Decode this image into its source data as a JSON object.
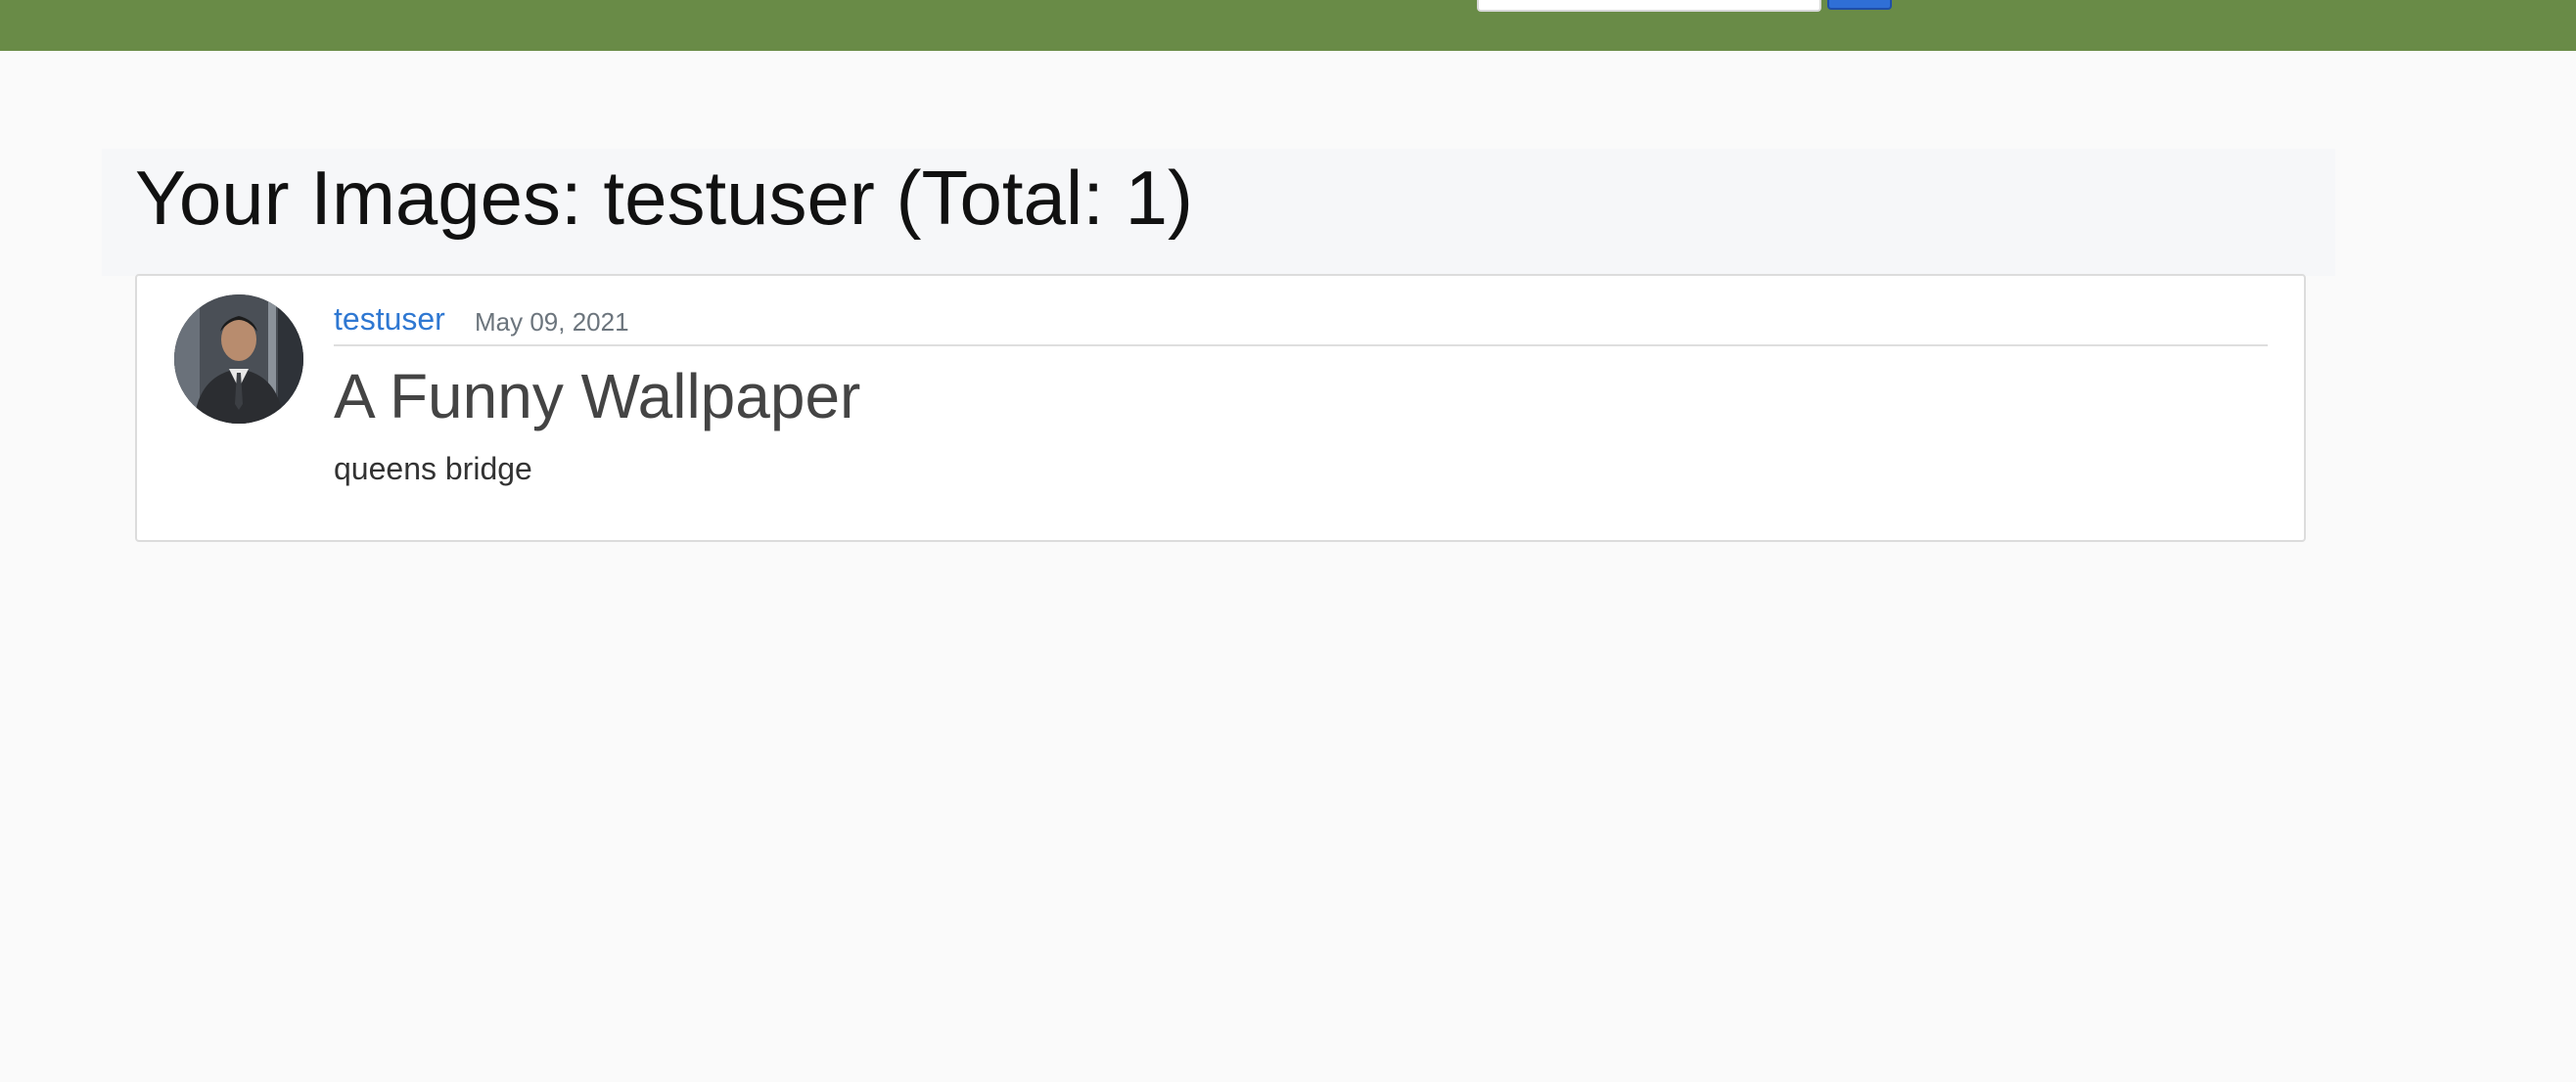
{
  "navbar": {
    "color": "#698b47",
    "search": {
      "placeholder": "",
      "value": ""
    },
    "search_button_color": "#2f6fd6"
  },
  "page": {
    "title": "Your Images: testuser (Total: 1)"
  },
  "posts": [
    {
      "author": "testuser",
      "date": "May 09, 2021",
      "title": "A Funny Wallpaper",
      "content": "queens bridge",
      "avatar_icon": "user-avatar-photo"
    }
  ],
  "colors": {
    "link": "#2f78d2",
    "muted": "#6c757d",
    "background": "#fafafa"
  }
}
